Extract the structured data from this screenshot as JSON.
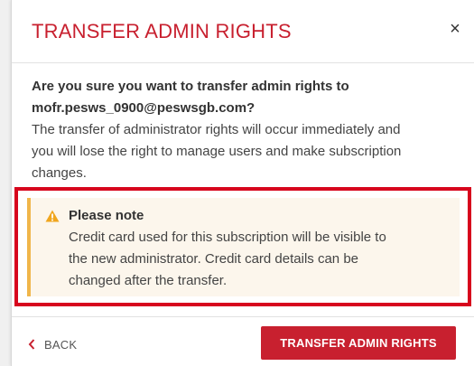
{
  "dialog": {
    "title": "TRANSFER ADMIN RIGHTS",
    "close_icon": "close-icon",
    "close_glyph": "×"
  },
  "body": {
    "question_line1": "Are you sure you want to transfer admin rights to",
    "question_line2": "mofr.pesws_0900@peswsgb.com?",
    "info_line1": "The transfer of administrator rights will occur immediately and",
    "info_line2": "you will lose the right to manage users and make subscription",
    "info_line3": "changes."
  },
  "note": {
    "icon": "warning-icon",
    "title": "Please note",
    "line1": "Credit card used for this subscription will be visible to",
    "line2": "the new administrator. Credit card details can be",
    "line3": "changed after the transfer."
  },
  "footer": {
    "back_label": "BACK",
    "back_icon": "chevron-left-icon",
    "confirm_label": "TRANSFER ADMIN RIGHTS"
  },
  "colors": {
    "brand_red": "#c8202f",
    "highlight_red": "#d7051d",
    "warning_amber": "#f0b64a",
    "note_background": "#fcf6ec"
  }
}
